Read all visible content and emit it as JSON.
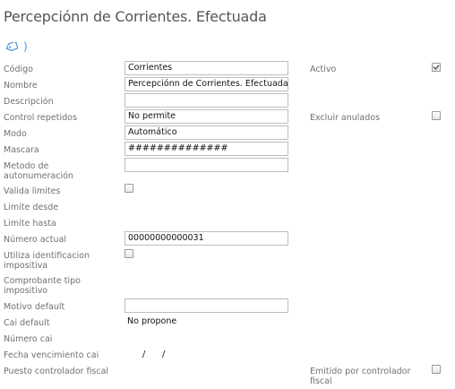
{
  "header": {
    "title": "Percepciónn de Corrientes. Efectuada",
    "paren": ")",
    "tag_icon": "tag-icon"
  },
  "form": {
    "codigo": {
      "label": "Código",
      "value": "Corrientes"
    },
    "nombre": {
      "label": "Nombre",
      "value": "Percepciónn de Corrientes. Efectuada"
    },
    "descripcion": {
      "label": "Descripción",
      "value": ""
    },
    "control_repetidos": {
      "label": "Control repetidos",
      "value": "No permite"
    },
    "modo": {
      "label": "Modo",
      "value": "Automático"
    },
    "mascara": {
      "label": "Mascara",
      "value": "##############"
    },
    "metodo_autonumeracion": {
      "label": "Metodo de autonumeración",
      "value": ""
    },
    "valida_limites": {
      "label": "Valida limites",
      "checked": false
    },
    "limite_desde": {
      "label": "Limite desde"
    },
    "limite_hasta": {
      "label": "Limite hasta"
    },
    "numero_actual": {
      "label": "Número actual",
      "value": "00000000000031"
    },
    "utiliza_identificacion": {
      "label": "Utiliza identificacion impositiva",
      "checked": false
    },
    "comprobante_tipo": {
      "label": "Comprobante tipo impositivo"
    },
    "motivo_default": {
      "label": "Motivo default",
      "value": ""
    },
    "cai_default": {
      "label": "Cai default",
      "value": "No propone"
    },
    "numero_cai": {
      "label": "Número cai"
    },
    "fecha_vencimiento_cai": {
      "label": "Fecha vencimiento cai",
      "sep1": "/",
      "sep2": "/"
    },
    "puesto_controlador": {
      "label": "Puesto controlador fiscal"
    }
  },
  "right": {
    "activo": {
      "label": "Activo",
      "checked": true
    },
    "excluir_anulados": {
      "label": "Excluir anulados",
      "checked": false
    },
    "emitido_controlador": {
      "label": "Emitido por controlador fiscal",
      "checked": false
    }
  }
}
